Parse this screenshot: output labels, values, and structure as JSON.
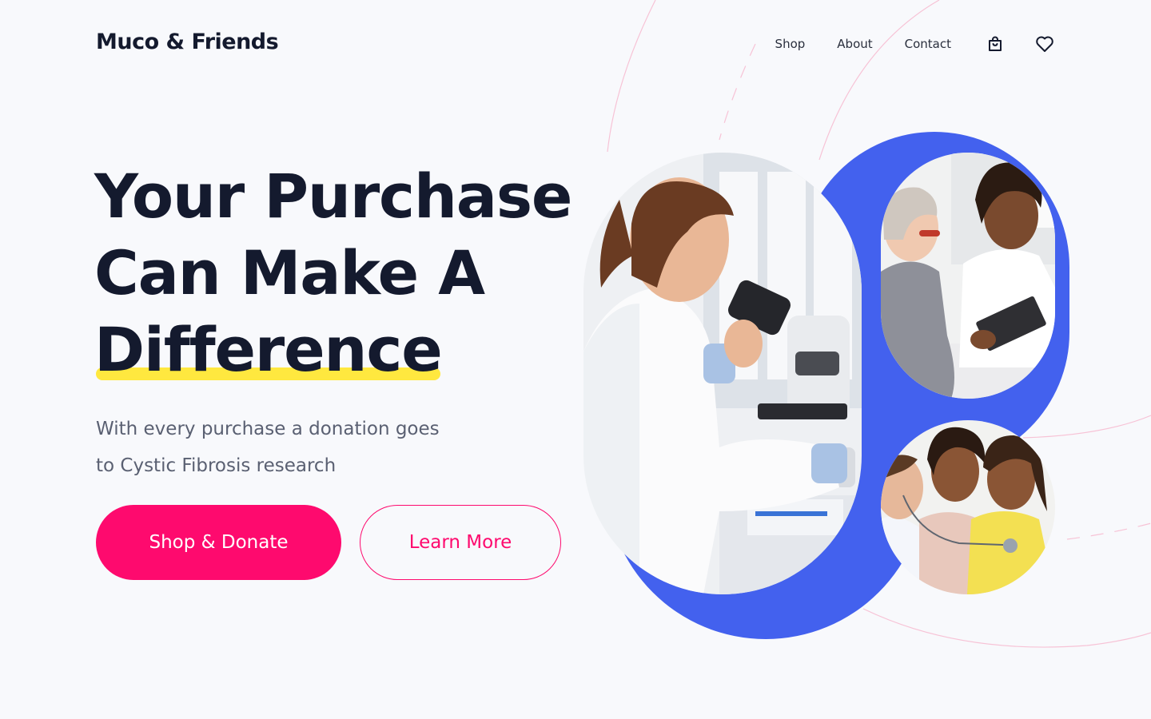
{
  "brand": {
    "name": "Muco & Friends"
  },
  "nav": {
    "links": [
      "Shop",
      "About",
      "Contact"
    ],
    "icons": [
      "shopping-bag-icon",
      "heart-icon"
    ]
  },
  "hero": {
    "headline_lines": [
      "Your Purchase",
      "Can Make A",
      "Difference"
    ],
    "subtext": "With every purchase a donation goes to Cystic Fibrosis research",
    "primary_cta": "Shop & Donate",
    "secondary_cta": "Learn More"
  },
  "photos": [
    "scientist-microscope-photo",
    "doctor-patient-consultation-photo",
    "family-doctor-visit-photo"
  ],
  "colors": {
    "background": "#f8f9fc",
    "text": "#141a2e",
    "muted": "#5a6072",
    "accent_pink": "#fe0a6e",
    "accent_blue": "#4361ee",
    "highlight_yellow": "#ffe83f"
  }
}
